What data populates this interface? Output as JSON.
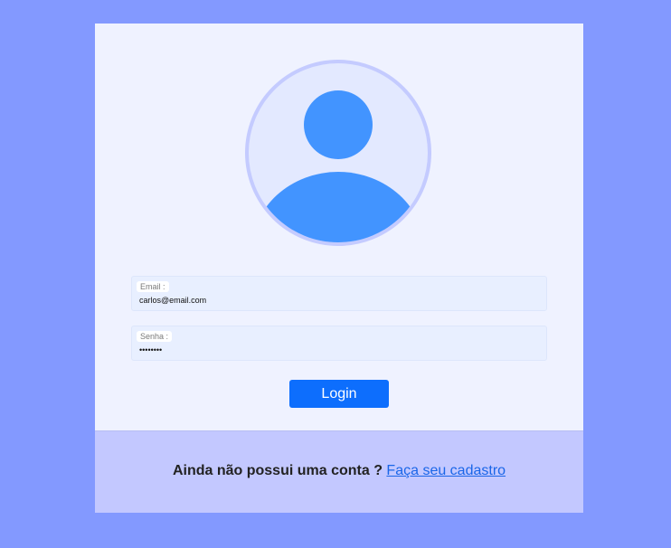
{
  "login_form": {
    "email_label": "Email :",
    "email_value": "carlos@email.com",
    "password_label": "Senha :",
    "password_value": "carlos12",
    "login_button_label": "Login"
  },
  "footer": {
    "question": "Ainda não possui uma conta ?",
    "signup_link": "Faça seu cadastro"
  },
  "colors": {
    "page_background": "#8399ff",
    "card_background": "#eff2ff",
    "avatar_fill": "#4294ff",
    "avatar_ring": "#c4cbff",
    "button": "#0d6efd",
    "footer_background": "#c3c8ff",
    "link": "#1a66e8"
  },
  "icons": {
    "avatar": "user-avatar-icon"
  }
}
